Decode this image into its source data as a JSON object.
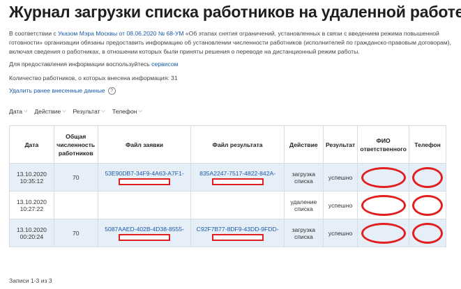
{
  "page": {
    "title": "Журнал загрузки списка работников на удаленной работе"
  },
  "intro": {
    "prefix": "В соответствии с ",
    "link": "Указом Мэра Москвы от 08.06.2020 № 68-УМ",
    "text": " «Об этапах снятия ограничений, установленных в связи с введением режима повышенной готовности» организации обязаны предоставить информацию об установлении численности работников (исполнителей по гражданско-правовым договорам), включая сведения о работниках, в отношении которых были приняты решения о переводе на дистанционный режим работы."
  },
  "service_line": {
    "text": "Для предоставления информации воспользуйтесь ",
    "link": "сервисом"
  },
  "count_line": "Количество работников, о которых внесена информация: 31",
  "delete_link": "Удалить ранее внесенные данные",
  "help_icon": "?",
  "filters": [
    {
      "label": "Дата"
    },
    {
      "label": "Действие"
    },
    {
      "label": "Результат"
    },
    {
      "label": "Телефон"
    }
  ],
  "table": {
    "headers": [
      "Дата",
      "Общая численность работников",
      "Файл заявки",
      "Файл результата",
      "Действие",
      "Результат",
      "ФИО ответственного",
      "Телефон"
    ],
    "rows": [
      {
        "date": "13.10.2020",
        "time": "10:35:12",
        "count": "70",
        "request_file": "53E90DB7-34F9-4A63-A7F1-",
        "result_file": "835A2247-7517-4822-842A-",
        "action": "загрузка списка",
        "result": "успешно"
      },
      {
        "date": "13.10.2020",
        "time": "10:27:22",
        "count": "",
        "request_file": "",
        "result_file": "",
        "action": "удаление списка",
        "result": "успешно"
      },
      {
        "date": "13.10.2020",
        "time": "00:20:24",
        "count": "70",
        "request_file": "5087AAED-402B-4D38-8555-",
        "result_file": "C92F7B77-8DF9-43DD-9FDD-",
        "action": "загрузка списка",
        "result": "успешно"
      }
    ]
  },
  "footer": "Записи 1-3 из 3",
  "colors": {
    "link": "#1a5aa8",
    "row_shade": "#e6eef8",
    "redaction": "#e02020",
    "border": "#d6dde6"
  }
}
